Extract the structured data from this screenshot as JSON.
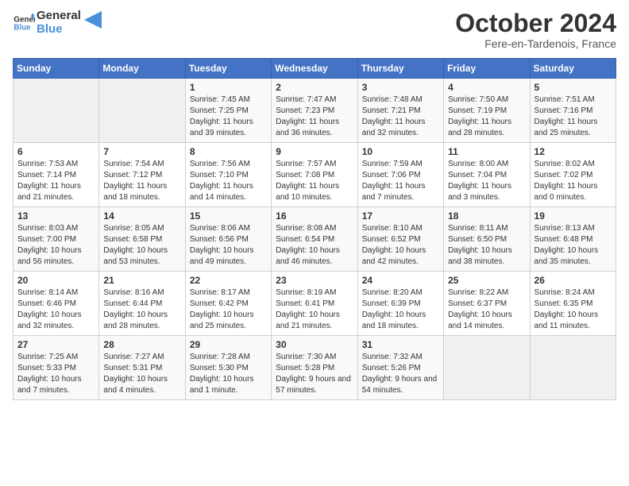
{
  "header": {
    "logo_line1": "General",
    "logo_line2": "Blue",
    "month": "October 2024",
    "location": "Fere-en-Tardenois, France"
  },
  "days_of_week": [
    "Sunday",
    "Monday",
    "Tuesday",
    "Wednesday",
    "Thursday",
    "Friday",
    "Saturday"
  ],
  "weeks": [
    [
      {
        "num": "",
        "text": ""
      },
      {
        "num": "",
        "text": ""
      },
      {
        "num": "1",
        "text": "Sunrise: 7:45 AM\nSunset: 7:25 PM\nDaylight: 11 hours and 39 minutes."
      },
      {
        "num": "2",
        "text": "Sunrise: 7:47 AM\nSunset: 7:23 PM\nDaylight: 11 hours and 36 minutes."
      },
      {
        "num": "3",
        "text": "Sunrise: 7:48 AM\nSunset: 7:21 PM\nDaylight: 11 hours and 32 minutes."
      },
      {
        "num": "4",
        "text": "Sunrise: 7:50 AM\nSunset: 7:19 PM\nDaylight: 11 hours and 28 minutes."
      },
      {
        "num": "5",
        "text": "Sunrise: 7:51 AM\nSunset: 7:16 PM\nDaylight: 11 hours and 25 minutes."
      }
    ],
    [
      {
        "num": "6",
        "text": "Sunrise: 7:53 AM\nSunset: 7:14 PM\nDaylight: 11 hours and 21 minutes."
      },
      {
        "num": "7",
        "text": "Sunrise: 7:54 AM\nSunset: 7:12 PM\nDaylight: 11 hours and 18 minutes."
      },
      {
        "num": "8",
        "text": "Sunrise: 7:56 AM\nSunset: 7:10 PM\nDaylight: 11 hours and 14 minutes."
      },
      {
        "num": "9",
        "text": "Sunrise: 7:57 AM\nSunset: 7:08 PM\nDaylight: 11 hours and 10 minutes."
      },
      {
        "num": "10",
        "text": "Sunrise: 7:59 AM\nSunset: 7:06 PM\nDaylight: 11 hours and 7 minutes."
      },
      {
        "num": "11",
        "text": "Sunrise: 8:00 AM\nSunset: 7:04 PM\nDaylight: 11 hours and 3 minutes."
      },
      {
        "num": "12",
        "text": "Sunrise: 8:02 AM\nSunset: 7:02 PM\nDaylight: 11 hours and 0 minutes."
      }
    ],
    [
      {
        "num": "13",
        "text": "Sunrise: 8:03 AM\nSunset: 7:00 PM\nDaylight: 10 hours and 56 minutes."
      },
      {
        "num": "14",
        "text": "Sunrise: 8:05 AM\nSunset: 6:58 PM\nDaylight: 10 hours and 53 minutes."
      },
      {
        "num": "15",
        "text": "Sunrise: 8:06 AM\nSunset: 6:56 PM\nDaylight: 10 hours and 49 minutes."
      },
      {
        "num": "16",
        "text": "Sunrise: 8:08 AM\nSunset: 6:54 PM\nDaylight: 10 hours and 46 minutes."
      },
      {
        "num": "17",
        "text": "Sunrise: 8:10 AM\nSunset: 6:52 PM\nDaylight: 10 hours and 42 minutes."
      },
      {
        "num": "18",
        "text": "Sunrise: 8:11 AM\nSunset: 6:50 PM\nDaylight: 10 hours and 38 minutes."
      },
      {
        "num": "19",
        "text": "Sunrise: 8:13 AM\nSunset: 6:48 PM\nDaylight: 10 hours and 35 minutes."
      }
    ],
    [
      {
        "num": "20",
        "text": "Sunrise: 8:14 AM\nSunset: 6:46 PM\nDaylight: 10 hours and 32 minutes."
      },
      {
        "num": "21",
        "text": "Sunrise: 8:16 AM\nSunset: 6:44 PM\nDaylight: 10 hours and 28 minutes."
      },
      {
        "num": "22",
        "text": "Sunrise: 8:17 AM\nSunset: 6:42 PM\nDaylight: 10 hours and 25 minutes."
      },
      {
        "num": "23",
        "text": "Sunrise: 8:19 AM\nSunset: 6:41 PM\nDaylight: 10 hours and 21 minutes."
      },
      {
        "num": "24",
        "text": "Sunrise: 8:20 AM\nSunset: 6:39 PM\nDaylight: 10 hours and 18 minutes."
      },
      {
        "num": "25",
        "text": "Sunrise: 8:22 AM\nSunset: 6:37 PM\nDaylight: 10 hours and 14 minutes."
      },
      {
        "num": "26",
        "text": "Sunrise: 8:24 AM\nSunset: 6:35 PM\nDaylight: 10 hours and 11 minutes."
      }
    ],
    [
      {
        "num": "27",
        "text": "Sunrise: 7:25 AM\nSunset: 5:33 PM\nDaylight: 10 hours and 7 minutes."
      },
      {
        "num": "28",
        "text": "Sunrise: 7:27 AM\nSunset: 5:31 PM\nDaylight: 10 hours and 4 minutes."
      },
      {
        "num": "29",
        "text": "Sunrise: 7:28 AM\nSunset: 5:30 PM\nDaylight: 10 hours and 1 minute."
      },
      {
        "num": "30",
        "text": "Sunrise: 7:30 AM\nSunset: 5:28 PM\nDaylight: 9 hours and 57 minutes."
      },
      {
        "num": "31",
        "text": "Sunrise: 7:32 AM\nSunset: 5:26 PM\nDaylight: 9 hours and 54 minutes."
      },
      {
        "num": "",
        "text": ""
      },
      {
        "num": "",
        "text": ""
      }
    ]
  ]
}
